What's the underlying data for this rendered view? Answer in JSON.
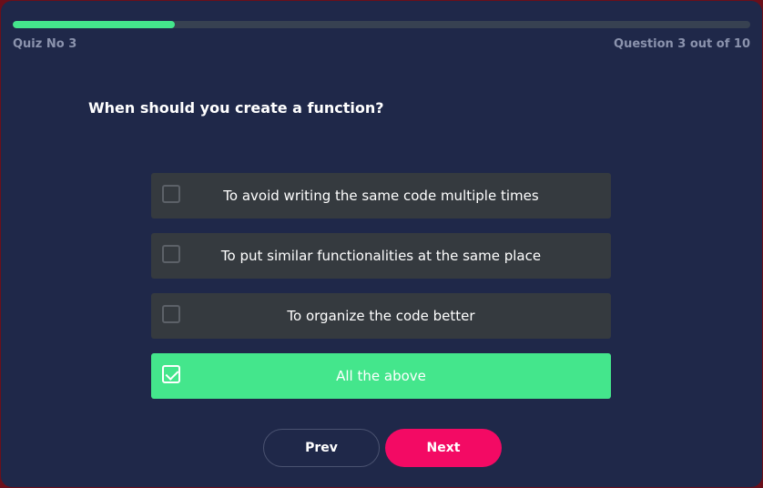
{
  "colors": {
    "background": "#1f2849",
    "accent": "#44e68c",
    "next_button": "#f30a64",
    "option_bg": "#353a3f",
    "muted_text": "#8b93ad"
  },
  "progress": {
    "fraction": 0.22
  },
  "header": {
    "quiz_label": "Quiz No 3",
    "counter": "Question 3 out of 10"
  },
  "question": {
    "text": "When should you create a function?"
  },
  "options": [
    {
      "label": "To avoid writing the same code multiple times",
      "checked": false
    },
    {
      "label": "To put similar functionalities at the same place",
      "checked": false
    },
    {
      "label": "To organize the code better",
      "checked": false
    },
    {
      "label": "All the above",
      "checked": true
    }
  ],
  "nav": {
    "prev_label": "Prev",
    "next_label": "Next"
  }
}
